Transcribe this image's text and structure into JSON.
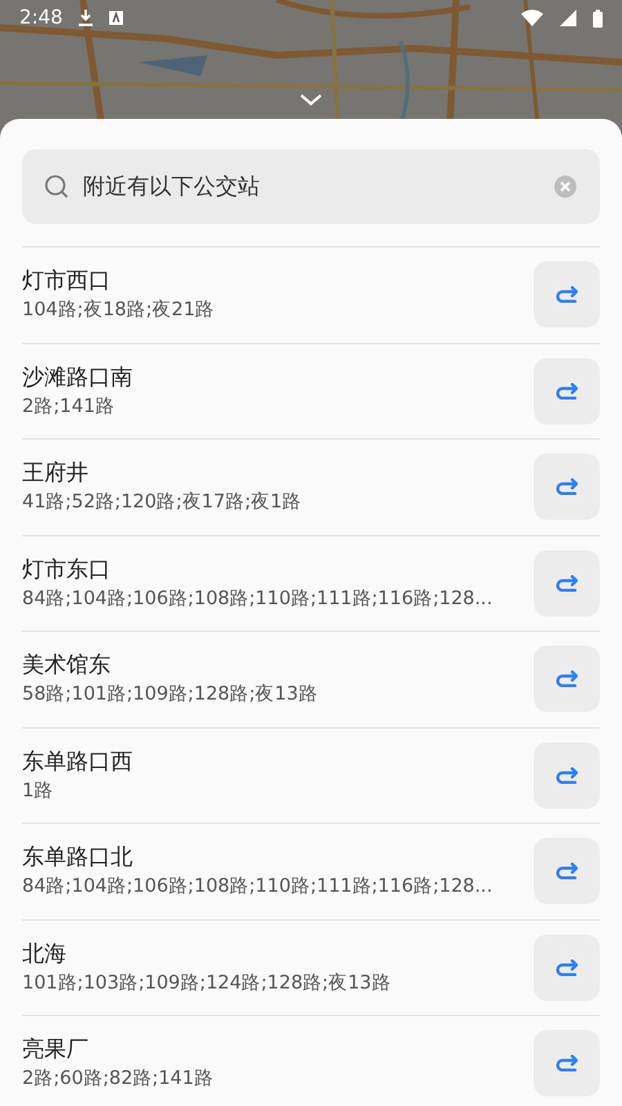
{
  "status_bar": {
    "time": "2:48"
  },
  "search": {
    "value": "附近有以下公交站"
  },
  "stations": [
    {
      "name": "灯市西口",
      "routes": "104路;夜18路;夜21路"
    },
    {
      "name": "沙滩路口南",
      "routes": "2路;141路"
    },
    {
      "name": "王府井",
      "routes": "41路;52路;120路;夜17路;夜1路"
    },
    {
      "name": "灯市东口",
      "routes": "84路;104路;106路;108路;110路;111路;116路;128..."
    },
    {
      "name": "美术馆东",
      "routes": "58路;101路;109路;128路;夜13路"
    },
    {
      "name": "东单路口西",
      "routes": "1路"
    },
    {
      "name": "东单路口北",
      "routes": "84路;104路;106路;108路;110路;111路;116路;128..."
    },
    {
      "name": "北海",
      "routes": "101路;103路;109路;124路;128路;夜13路"
    },
    {
      "name": "亮果厂",
      "routes": "2路;60路;82路;141路"
    }
  ]
}
